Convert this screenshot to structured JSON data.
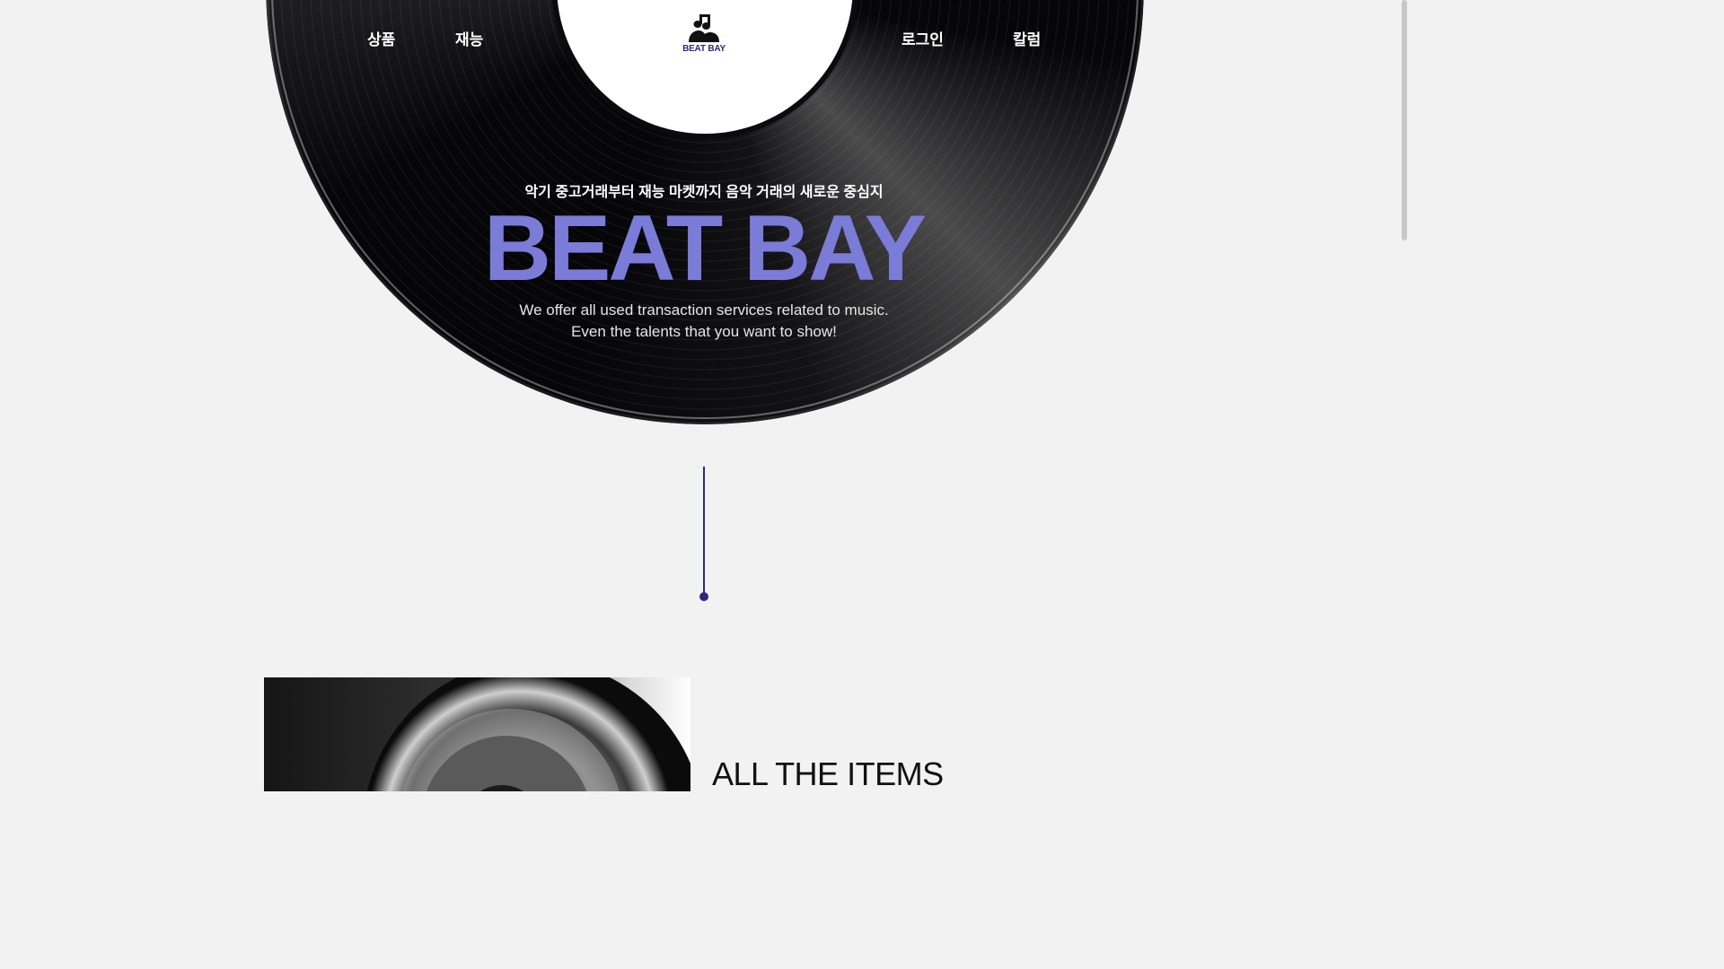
{
  "nav": {
    "products_label": "상품",
    "talents_label": "재능",
    "login_label": "로그인",
    "column_label": "칼럼"
  },
  "logo": {
    "text": "BEAT BAY",
    "icon": "music-note-people-icon",
    "color": "#2d2a7a"
  },
  "hero": {
    "kicker": "악기 중고거래부터 재능 마켓까지 음악 거래의 새로운 중심지",
    "title": "BEAT BAY",
    "title_color": "#7b7bd8",
    "description_line1": "We offer all used transaction services related to music.",
    "description_line2": "Even the talents that you want to show!"
  },
  "scroll_indicator": {
    "color": "#2d2a7a"
  },
  "section": {
    "title": "ALL THE ITEMS"
  },
  "colors": {
    "background": "#f2f2f2",
    "vinyl": "#060608",
    "accent": "#2d2a7a"
  }
}
